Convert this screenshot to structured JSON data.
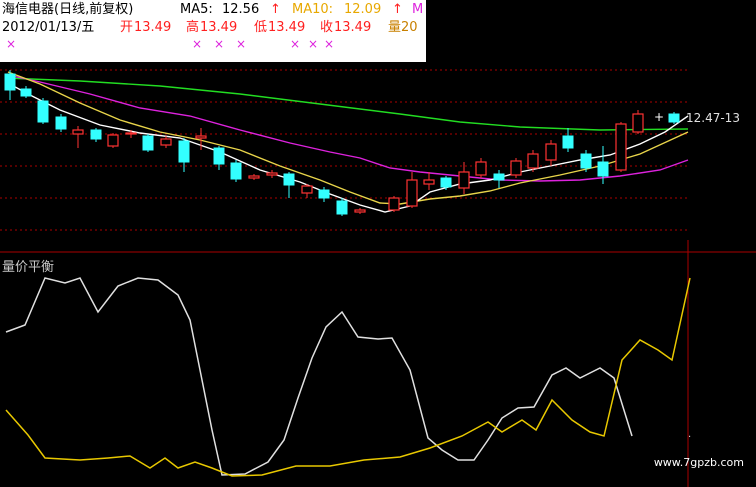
{
  "header": {
    "stock_title": "海信电器(日线,前复权)",
    "ma5_label": "MA5:",
    "ma5_value": "12.56",
    "ma10_label": "MA10:",
    "ma10_value": "12.09",
    "date": "2012/01/13/五",
    "open_label": "开",
    "open_value": "13.49",
    "high_label": "高",
    "high_value": "13.49",
    "low_label": "低",
    "low_value": "13.49",
    "close_label": "收",
    "close_value": "13.49",
    "volume_label": "量20",
    "cross_marks": [
      "×",
      "×",
      "×",
      "×",
      "×",
      "×",
      "×"
    ]
  },
  "price_range_label": "12.47-13",
  "indicator": {
    "title": "量价平衡"
  },
  "watermark": "www.7gpzb.com",
  "colors": {
    "up": "#ff3333",
    "down": "#33ffff",
    "ma5": "#ffffff",
    "ma10": "#e8d44a",
    "ma20": "#dd22dd",
    "ma60": "#22dd22",
    "grid": "#aa0000",
    "indicator_white": "#e0e0e0",
    "indicator_yellow": "#e8c800"
  },
  "chart_data": [
    {
      "type": "candlestick",
      "title": "海信电器(日线,前复权)",
      "series": [
        {
          "name": "MA5",
          "values": [
            12.56
          ]
        },
        {
          "name": "MA10",
          "values": [
            12.09
          ]
        }
      ],
      "last_bar": {
        "date": "2012/01/13",
        "open": 13.49,
        "high": 13.49,
        "low": 13.49,
        "close": 13.49
      }
    },
    {
      "type": "line",
      "title": "量价平衡"
    }
  ]
}
